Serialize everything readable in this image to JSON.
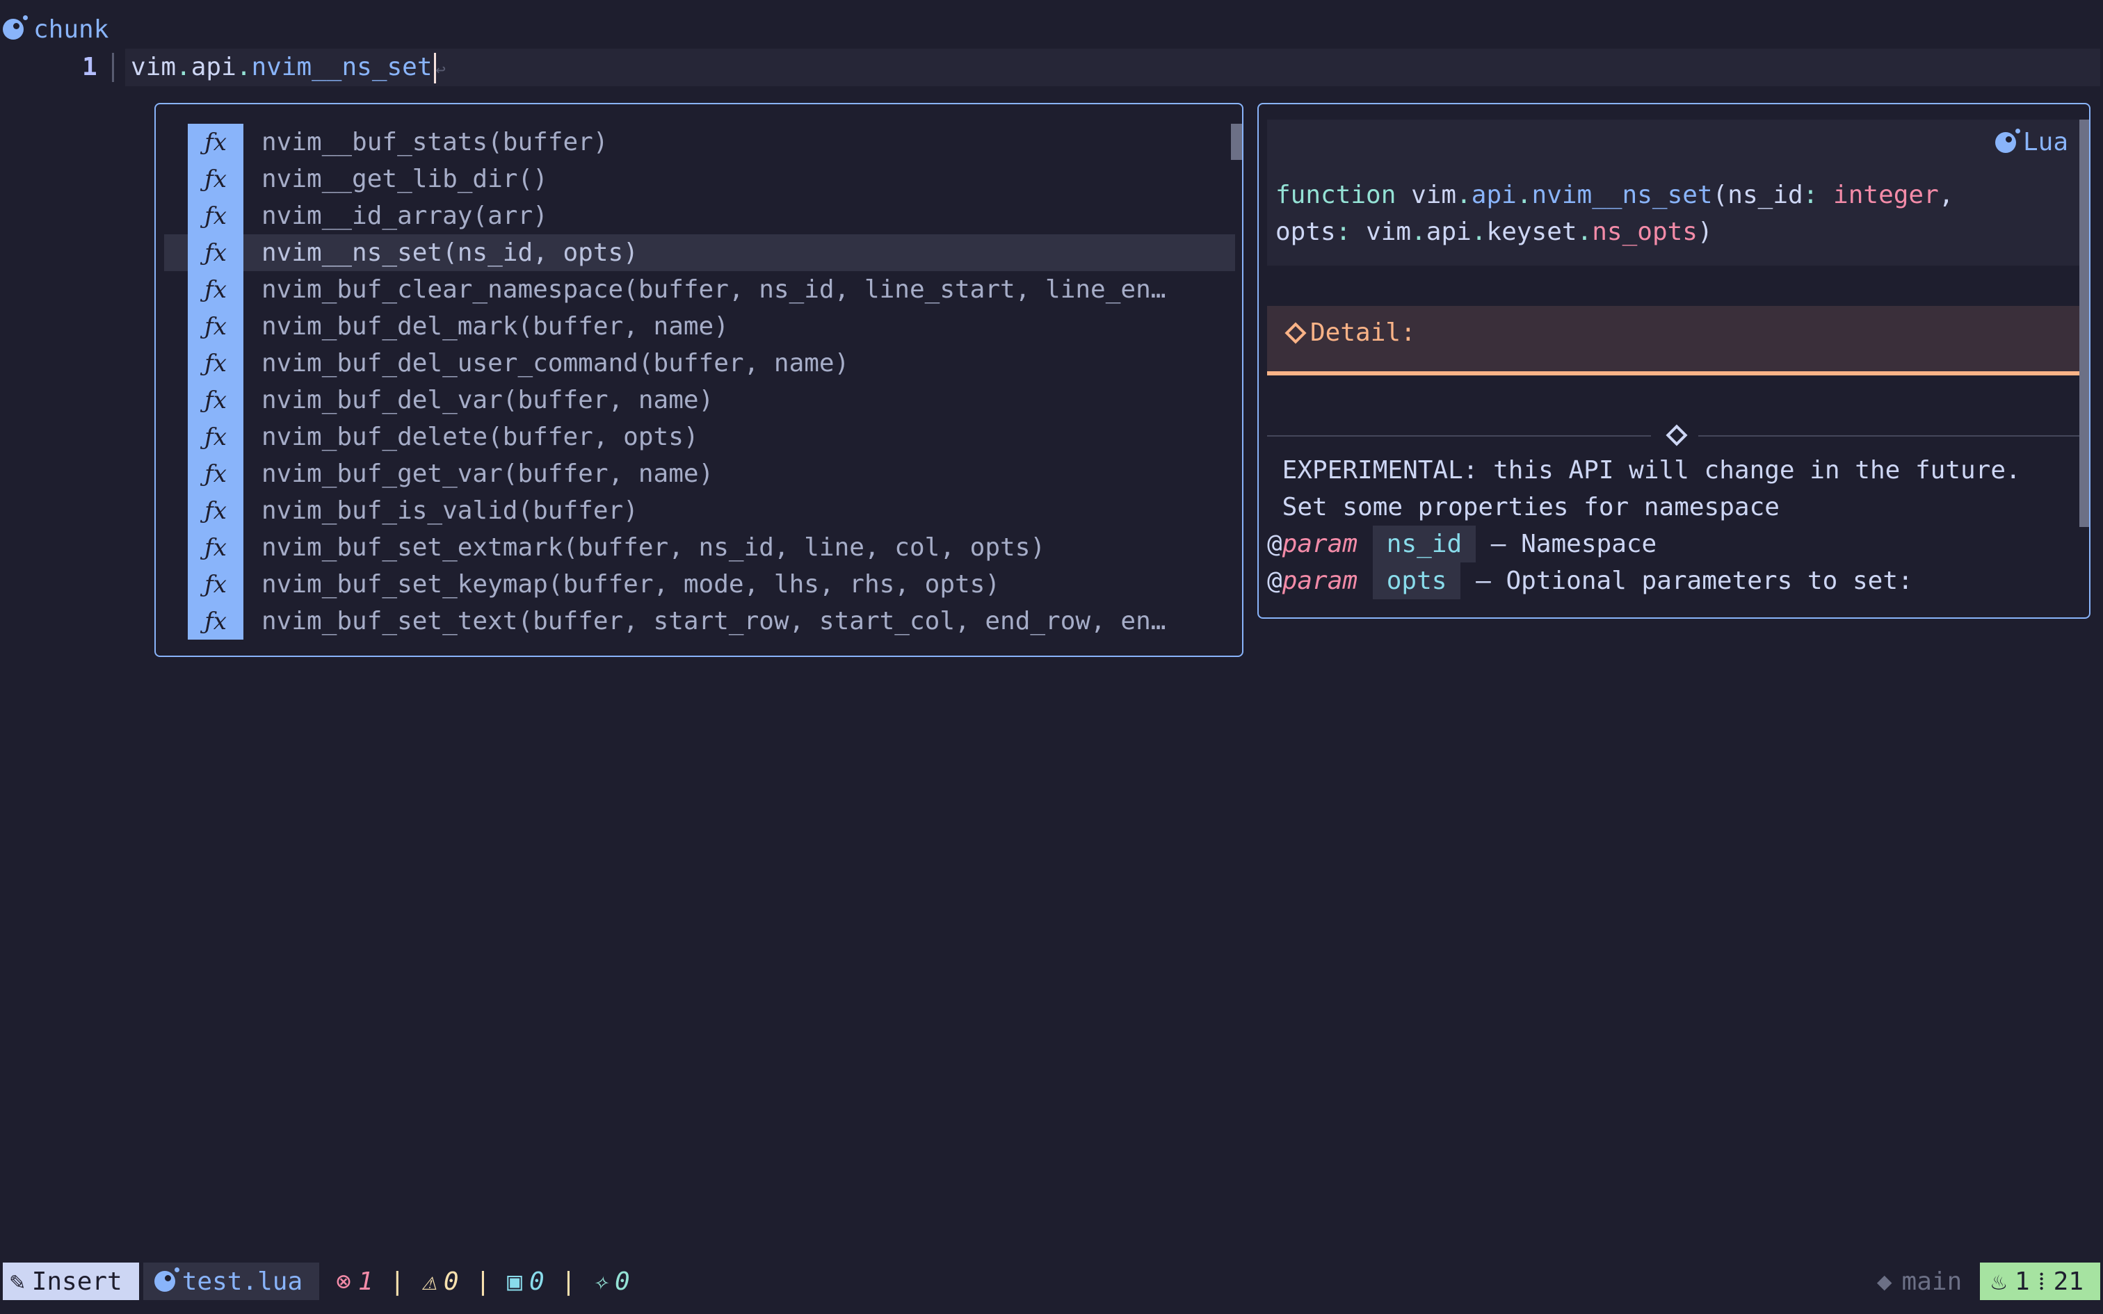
{
  "winbar": {
    "title": "chunk"
  },
  "buffer": {
    "line_number": "1",
    "code_vim": "vim",
    "code_dot1": ".",
    "code_api": "api",
    "code_dot2": ".",
    "code_fn": "nvim__ns_set",
    "eol_symbol": "↩"
  },
  "completion": {
    "kind_symbol": "ƒx",
    "selected_index": 3,
    "items": [
      "nvim__buf_stats(buffer)",
      "nvim__get_lib_dir()",
      "nvim__id_array(arr)",
      "nvim__ns_set(ns_id, opts)",
      "nvim_buf_clear_namespace(buffer, ns_id, line_start, line_en…",
      "nvim_buf_del_mark(buffer, name)",
      "nvim_buf_del_user_command(buffer, name)",
      "nvim_buf_del_var(buffer, name)",
      "nvim_buf_delete(buffer, opts)",
      "nvim_buf_get_var(buffer, name)",
      "nvim_buf_is_valid(buffer)",
      "nvim_buf_set_extmark(buffer, ns_id, line, col, opts)",
      "nvim_buf_set_keymap(buffer, mode, lhs, rhs, opts)",
      "nvim_buf_set_text(buffer, start_row, start_col, end_row, en…"
    ]
  },
  "docs": {
    "language": "Lua",
    "sig": {
      "kw": "function",
      "a": "vim",
      "b": "api",
      "name": "nvim__ns_set",
      "p1": "ns_id",
      "t1": "integer",
      "p2": "opts",
      "t2a": "vim",
      "t2b": "api",
      "t2c": "keyset",
      "t2d": "ns_opts"
    },
    "detail_label": "Detail:",
    "line1": " EXPERIMENTAL: this API will change in the future.",
    "line2": " Set some properties for namespace",
    "param_at": "@",
    "param_kw": "param",
    "param1_name": "ns_id",
    "param1_desc": " — Namespace",
    "param2_name": "opts",
    "param2_desc": " — Optional parameters to set:"
  },
  "statusline": {
    "mode": "Insert",
    "file": "test.lua",
    "errors": "1",
    "warnings": "0",
    "info": "0",
    "hints": "0",
    "separator": "|",
    "branch": "main",
    "line": "1",
    "col": "21"
  },
  "colors": {
    "background": "#1e1e2e",
    "accent": "#89b4fa",
    "mode_bg": "#cdd6f4",
    "position_bg": "#a6e3a1",
    "detail_accent": "#fab387"
  }
}
